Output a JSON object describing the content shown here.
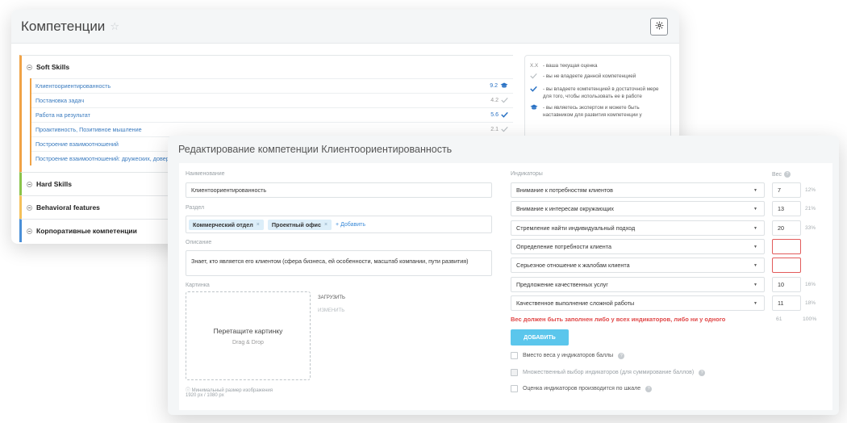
{
  "back_window": {
    "title": "Компетенции",
    "groups": [
      {
        "name": "Soft Skills"
      },
      {
        "name": "Hard Skills"
      },
      {
        "name": "Behavioral features"
      },
      {
        "name": "Корпоративные компетенции"
      }
    ],
    "soft_items": [
      {
        "label": "Клиентоориентированность",
        "score": "9.2",
        "icon": "graduation-cap-icon"
      },
      {
        "label": "Постановка задач",
        "score": "4.2",
        "icon": "check-icon"
      },
      {
        "label": "Работа на результат",
        "score": "5.6",
        "icon": "check-icon"
      },
      {
        "label": "Проактивность, Позитивное мышление",
        "score": "2.1",
        "icon": "check-icon"
      },
      {
        "label": "Построение взаимоотношений",
        "score": "",
        "icon": ""
      },
      {
        "label": "Построение взаимоотношений: дружеских, довери",
        "score": "",
        "icon": ""
      }
    ],
    "legend": {
      "xx_mark": "X.X",
      "xx_text": "- ваша текущая оценка",
      "gray_check_text": "- вы не владеете данной компетенцией",
      "blue_check_text": "- вы владеете компетенцией в достаточной мере для того, чтобы использовать ее в работе",
      "cap_text": "- вы являетесь экспертом и можете быть наставником для развития компетенции у"
    }
  },
  "dialog": {
    "title": "Редактирование компетенции Клиентоориентированность",
    "name_label": "Наименование",
    "name_value": "Клиентоориентированность",
    "section_label": "Раздел",
    "section_tags": [
      "Коммерческий отдел",
      "Проектный офис"
    ],
    "add_link": "+ Добавить",
    "description_label": "Описание",
    "description_value": "Знает, кто является его клиентом (сфера бизнеса, ей особенности, масштаб компании, пути развития)",
    "image_label": "Картинка",
    "drop_title": "Перетащите картинку",
    "drop_sub": "Drag & Drop",
    "upload_btn": "ЗАГРУЗИТЬ",
    "change_btn": "ИЗМЕНИТЬ",
    "min_size_note": "ⓘ Минимальный размер изображения",
    "min_size_value": "1920 px / 1080 px",
    "indicators_label": "Индикаторы",
    "weight_label": "Вес",
    "indicators": [
      {
        "name": "Внимание к потребностям клиентов",
        "weight": "7",
        "pct": "12%",
        "error": false
      },
      {
        "name": "Внимание к интересам окружающих",
        "weight": "13",
        "pct": "21%",
        "error": false
      },
      {
        "name": "Стремление найти индивидуальный подход",
        "weight": "20",
        "pct": "33%",
        "error": false
      },
      {
        "name": "Определение потребности клиента",
        "weight": "",
        "pct": "",
        "error": true
      },
      {
        "name": "Серьезное отношение к жалобам клиента",
        "weight": "",
        "pct": "",
        "error": true
      },
      {
        "name": "Предложение качественных услуг",
        "weight": "10",
        "pct": "16%",
        "error": false
      },
      {
        "name": "Качественное выполнение сложной работы",
        "weight": "11",
        "pct": "18%",
        "error": false
      }
    ],
    "error_message": "Вес должен быть заполнен либо у всех индикаторов, либо ни у одного",
    "total_weight": "61",
    "total_pct": "100%",
    "add_button": "ДОБАВИТЬ",
    "options": [
      {
        "label": "Вместо веса у индикаторов баллы",
        "disabled": false
      },
      {
        "label": "Множественный выбор индикаторов (для суммирование баллов)",
        "disabled": true
      },
      {
        "label": "Оценка индикаторов производится по шкале",
        "disabled": false
      }
    ]
  },
  "colors": {
    "soft": "#f0a347",
    "hard": "#8bc34a",
    "behavioral": "#f4c05a",
    "corporate": "#4a8fd8",
    "link": "#3a7bbf",
    "button": "#5bc6ec",
    "error": "#e04848"
  }
}
